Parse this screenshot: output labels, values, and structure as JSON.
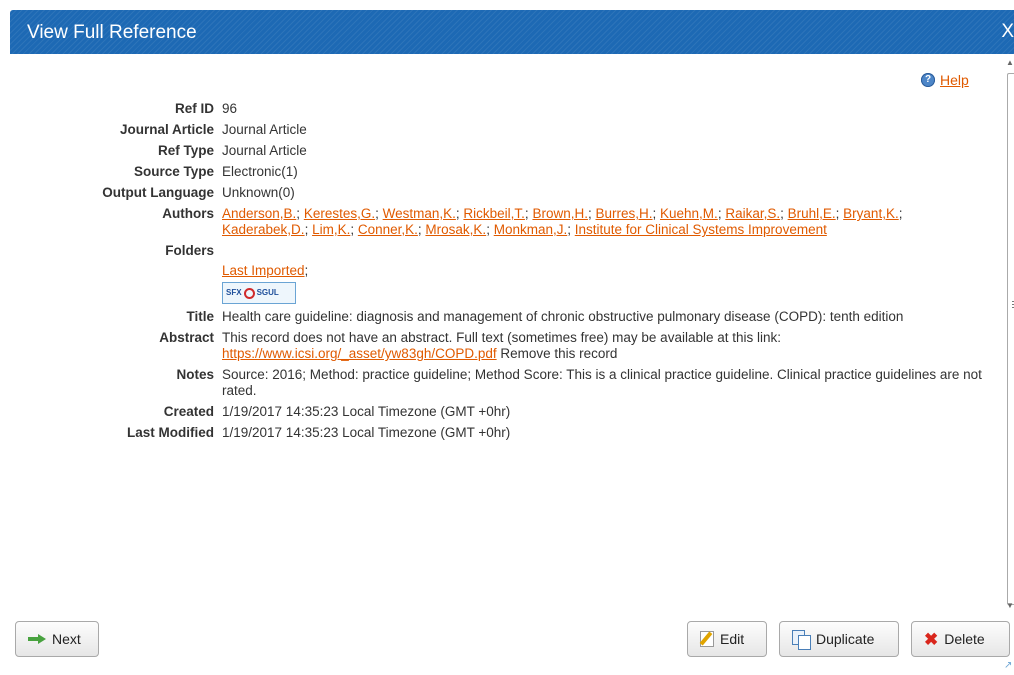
{
  "dialog": {
    "title": "View Full Reference",
    "close_label": "X"
  },
  "help": {
    "icon": "?",
    "label": "Help"
  },
  "reference": {
    "ref_id": {
      "label": "Ref ID",
      "value": "96"
    },
    "journal_article": {
      "label": "Journal Article",
      "value": "Journal Article"
    },
    "ref_type": {
      "label": "Ref Type",
      "value": "Journal Article"
    },
    "source_type": {
      "label": "Source Type",
      "value": "Electronic(1)"
    },
    "output_language": {
      "label": "Output Language",
      "value": "Unknown(0)"
    },
    "authors": {
      "label": "Authors",
      "items": [
        "Anderson,B.",
        "Kerestes,G.",
        "Westman,K.",
        "Rickbeil,T.",
        "Brown,H.",
        "Burres,H.",
        "Kuehn,M.",
        "Raikar,S.",
        "Bruhl,E.",
        "Bryant,K.",
        "Kaderabek,D.",
        "Lim,K.",
        "Conner,K.",
        "Mrosak,K.",
        "Monkman,J.",
        "Institute for Clinical Systems Improvement"
      ]
    },
    "folders": {
      "label": "Folders",
      "items": [
        "Last Imported"
      ],
      "separator": ";"
    },
    "sfx_logo": {
      "left": "SFX",
      "right": "SGUL"
    },
    "title": {
      "label": "Title",
      "value": "Health care guideline: diagnosis and management of chronic obstructive pulmonary disease (COPD): tenth edition"
    },
    "abstract": {
      "label": "Abstract",
      "text": "This record does not have an abstract. Full text (sometimes free) may be available at this link:",
      "link": "https://www.icsi.org/_asset/yw83gh/COPD.pdf",
      "remove_label": "Remove this record"
    },
    "notes": {
      "label": "Notes",
      "value": "Source: 2016; Method: practice guideline; Method Score: This is a clinical practice guideline. Clinical practice guidelines are not rated."
    },
    "created": {
      "label": "Created",
      "value": "1/19/2017 14:35:23 Local Timezone (GMT +0hr)"
    },
    "last_modified": {
      "label": "Last Modified",
      "value": "1/19/2017 14:35:23 Local Timezone (GMT +0hr)"
    }
  },
  "buttons": {
    "next": "Next",
    "edit": "Edit",
    "duplicate": "Duplicate",
    "delete": "Delete"
  },
  "colors": {
    "titlebar": "#1d69b4",
    "link": "#e05a00",
    "delete_icon": "#d9261c",
    "next_icon": "#48a23f"
  }
}
